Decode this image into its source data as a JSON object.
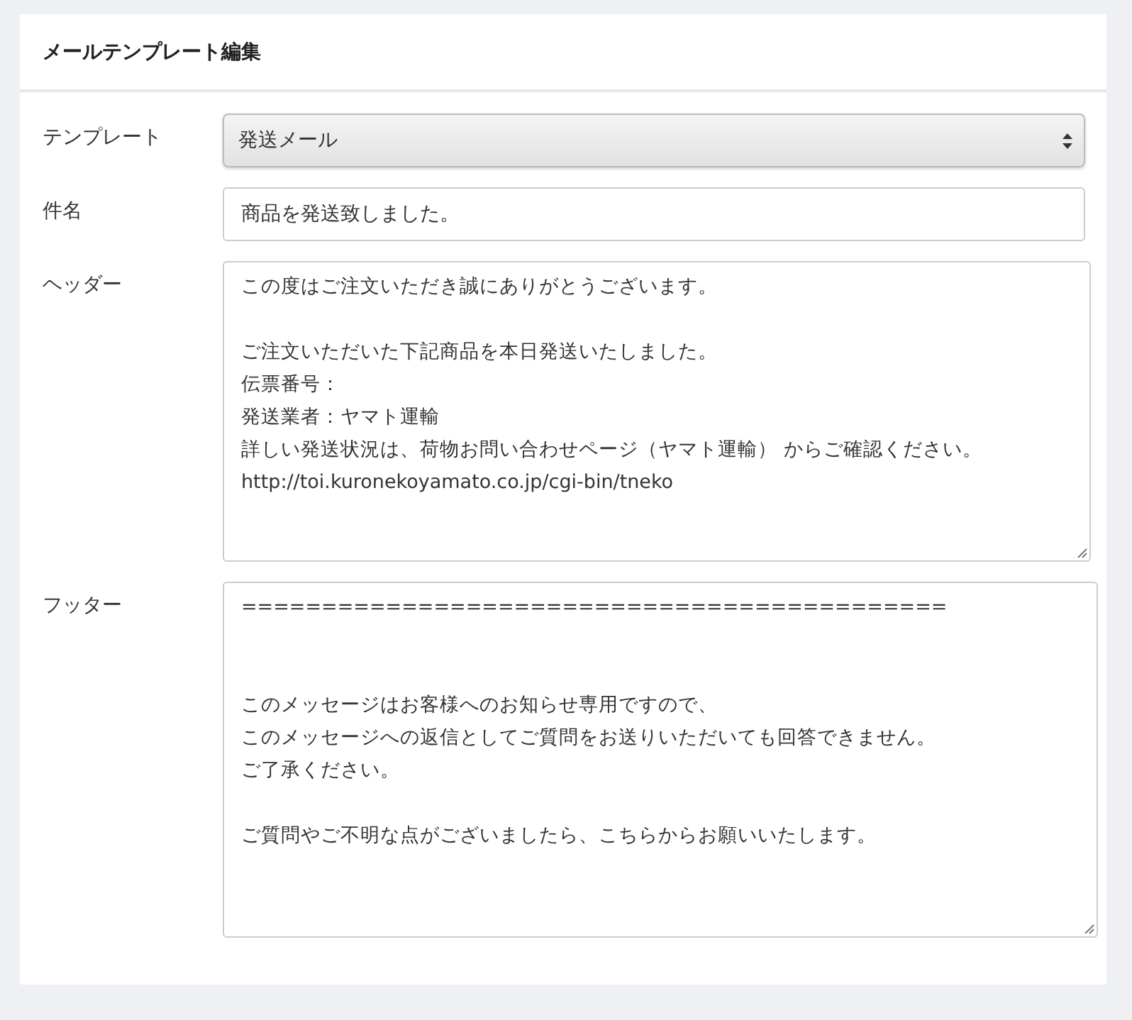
{
  "title": "メールテンプレート編集",
  "fields": [
    {
      "kind": "select",
      "label": "テンプレート",
      "value": "発送メール"
    },
    {
      "kind": "input",
      "label": "件名",
      "value": "商品を発送致しました。"
    },
    {
      "kind": "textarea",
      "label": "ヘッダー",
      "paragraphs": [
        {
          "kind": "text",
          "lines": [
            "この度はご注文いただき誠にありがとうございます。"
          ]
        },
        {
          "kind": "text",
          "lines": [
            "ご注文いただいた下記商品を本日発送いたしました。",
            "伝票番号：",
            "発送業者：ヤマト運輸",
            "詳しい発送状況は、荷物お問い合わせページ（ヤマト運輸） からご確認ください。",
            "http://toi.kuronekoyamato.co.jp/cgi-bin/tneko"
          ]
        }
      ]
    },
    {
      "kind": "textarea",
      "label": "フッター",
      "paragraphs": [
        {
          "kind": "rule",
          "lines": [
            "============================================"
          ]
        },
        {
          "kind": "text",
          "lines": [
            "このメッセージはお客様へのお知らせ専用ですので、",
            "このメッセージへの返信としてご質問をお送りいただいても回答できません。",
            "ご了承ください。"
          ]
        },
        {
          "kind": "text",
          "lines": [
            "ご質問やご不明な点がございましたら、こちらからお願いいたします。"
          ]
        }
      ]
    }
  ]
}
